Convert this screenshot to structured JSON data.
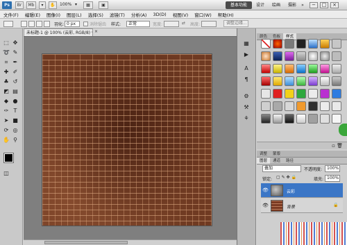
{
  "title_bar": {
    "app_logo": "Ps",
    "zoom": "100%",
    "workspaces": [
      "基本功能",
      "设计",
      "绘画",
      "摄影"
    ],
    "more_glyph": "»",
    "window_controls": [
      "−",
      "□",
      "×"
    ]
  },
  "menu": [
    "文件(F)",
    "编辑(E)",
    "图像(I)",
    "图层(L)",
    "选择(S)",
    "滤镜(T)",
    "分析(A)",
    "3D(D)",
    "视图(V)",
    "窗口(W)",
    "帮助(H)"
  ],
  "options_bar": {
    "feather_label": "羽化:",
    "feather_value": "0 px",
    "antialias_label": "消除锯齿",
    "style_label": "样式:",
    "style_value": "正常",
    "width_label": "宽度:",
    "height_label": "高度:",
    "refine_edge": "调整边缘..."
  },
  "document": {
    "tab_title": "未标题-1 @ 100% (云彩, RGB/8) *",
    "close_glyph": "×"
  },
  "panels": {
    "top_tabs": [
      "颜色",
      "色板",
      "样式"
    ],
    "mid_tabs": [
      "调整",
      "蒙版"
    ],
    "layer_tabs": [
      "图层",
      "通道",
      "路径"
    ]
  },
  "layers": {
    "blend_mode": "叠加",
    "opacity_label": "不透明度:",
    "opacity_value": "100%",
    "lock_label": "锁定:",
    "fill_label": "填充:",
    "fill_value": "100%",
    "items": [
      {
        "name": "云彩",
        "selected": true
      },
      {
        "name": "背景",
        "selected": false
      }
    ]
  },
  "colors": {
    "accent": "#3b76c6",
    "foreground": "#000000",
    "background": "#ffffff",
    "brick": "#6f3a22"
  }
}
